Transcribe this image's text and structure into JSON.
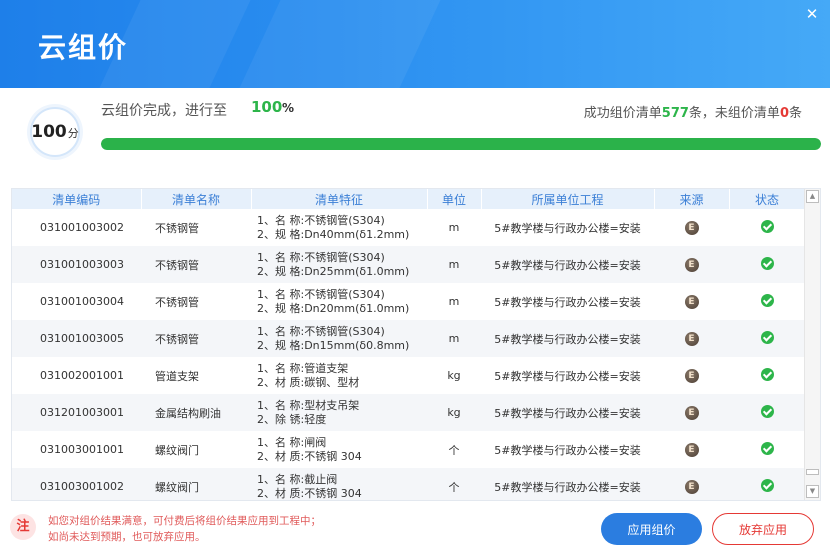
{
  "window": {
    "title": "云组价",
    "close_glyph": "✕"
  },
  "score": {
    "value": "100",
    "unit": "分"
  },
  "progress": {
    "text": "云组价完成，进行至",
    "percent": "100",
    "percent_unit": "%",
    "fraction": 1.0
  },
  "summary": {
    "success_prefix": "成功组价清单",
    "success_count": "577",
    "success_suffix": "条，未组价清单",
    "fail_count": "0",
    "fail_suffix": "条"
  },
  "table": {
    "columns": [
      "清单编码",
      "清单名称",
      "清单特征",
      "单位",
      "所属单位工程",
      "来源",
      "状态"
    ],
    "rows": [
      {
        "code": "031001003002",
        "name": "不锈钢管",
        "feat1": "1、名 称:不锈钢管(S304)",
        "feat2": "2、规 格:Dn40mm(δ1.2mm)",
        "unit": "m",
        "project": "5#教学楼与行政办公楼=安装",
        "source": "E"
      },
      {
        "code": "031001003003",
        "name": "不锈钢管",
        "feat1": "1、名 称:不锈钢管(S304)",
        "feat2": "2、规 格:Dn25mm(δ1.0mm)",
        "unit": "m",
        "project": "5#教学楼与行政办公楼=安装",
        "source": "E"
      },
      {
        "code": "031001003004",
        "name": "不锈钢管",
        "feat1": "1、名 称:不锈钢管(S304)",
        "feat2": "2、规 格:Dn20mm(δ1.0mm)",
        "unit": "m",
        "project": "5#教学楼与行政办公楼=安装",
        "source": "E"
      },
      {
        "code": "031001003005",
        "name": "不锈钢管",
        "feat1": "1、名 称:不锈钢管(S304)",
        "feat2": "2、规 格:Dn15mm(δ0.8mm)",
        "unit": "m",
        "project": "5#教学楼与行政办公楼=安装",
        "source": "E"
      },
      {
        "code": "031002001001",
        "name": "管道支架",
        "feat1": "1、名 称:管道支架",
        "feat2": "2、材 质:碳钢、型材",
        "unit": "kg",
        "project": "5#教学楼与行政办公楼=安装",
        "source": "E"
      },
      {
        "code": "031201003001",
        "name": "金属结构刷油",
        "feat1": "1、名 称:型材支吊架",
        "feat2": "2、除 锈:轻度",
        "unit": "kg",
        "project": "5#教学楼与行政办公楼=安装",
        "source": "E"
      },
      {
        "code": "031003001001",
        "name": "螺纹阀门",
        "feat1": "1、名 称:闸阀",
        "feat2": "2、材 质:不锈钢 304",
        "unit": "个",
        "project": "5#教学楼与行政办公楼=安装",
        "source": "E"
      },
      {
        "code": "031003001002",
        "name": "螺纹阀门",
        "feat1": "1、名 称:截止阀",
        "feat2": "2、材 质:不锈钢 304",
        "unit": "个",
        "project": "5#教学楼与行政办公楼=安装",
        "source": "E"
      }
    ]
  },
  "note": {
    "badge": "注",
    "line1": "如您对组价结果满意，可付费后将组价结果应用到工程中；",
    "line2": "如尚未达到预期，也可放弃应用。"
  },
  "buttons": {
    "apply": "应用组价",
    "discard": "放弃应用"
  },
  "scrollbar": {
    "up_glyph": "▲",
    "down_glyph": "▼"
  },
  "colors": {
    "header": "#2a8ef0",
    "success": "#2db54a",
    "danger": "#e53935",
    "accent": "#2b7de0"
  }
}
